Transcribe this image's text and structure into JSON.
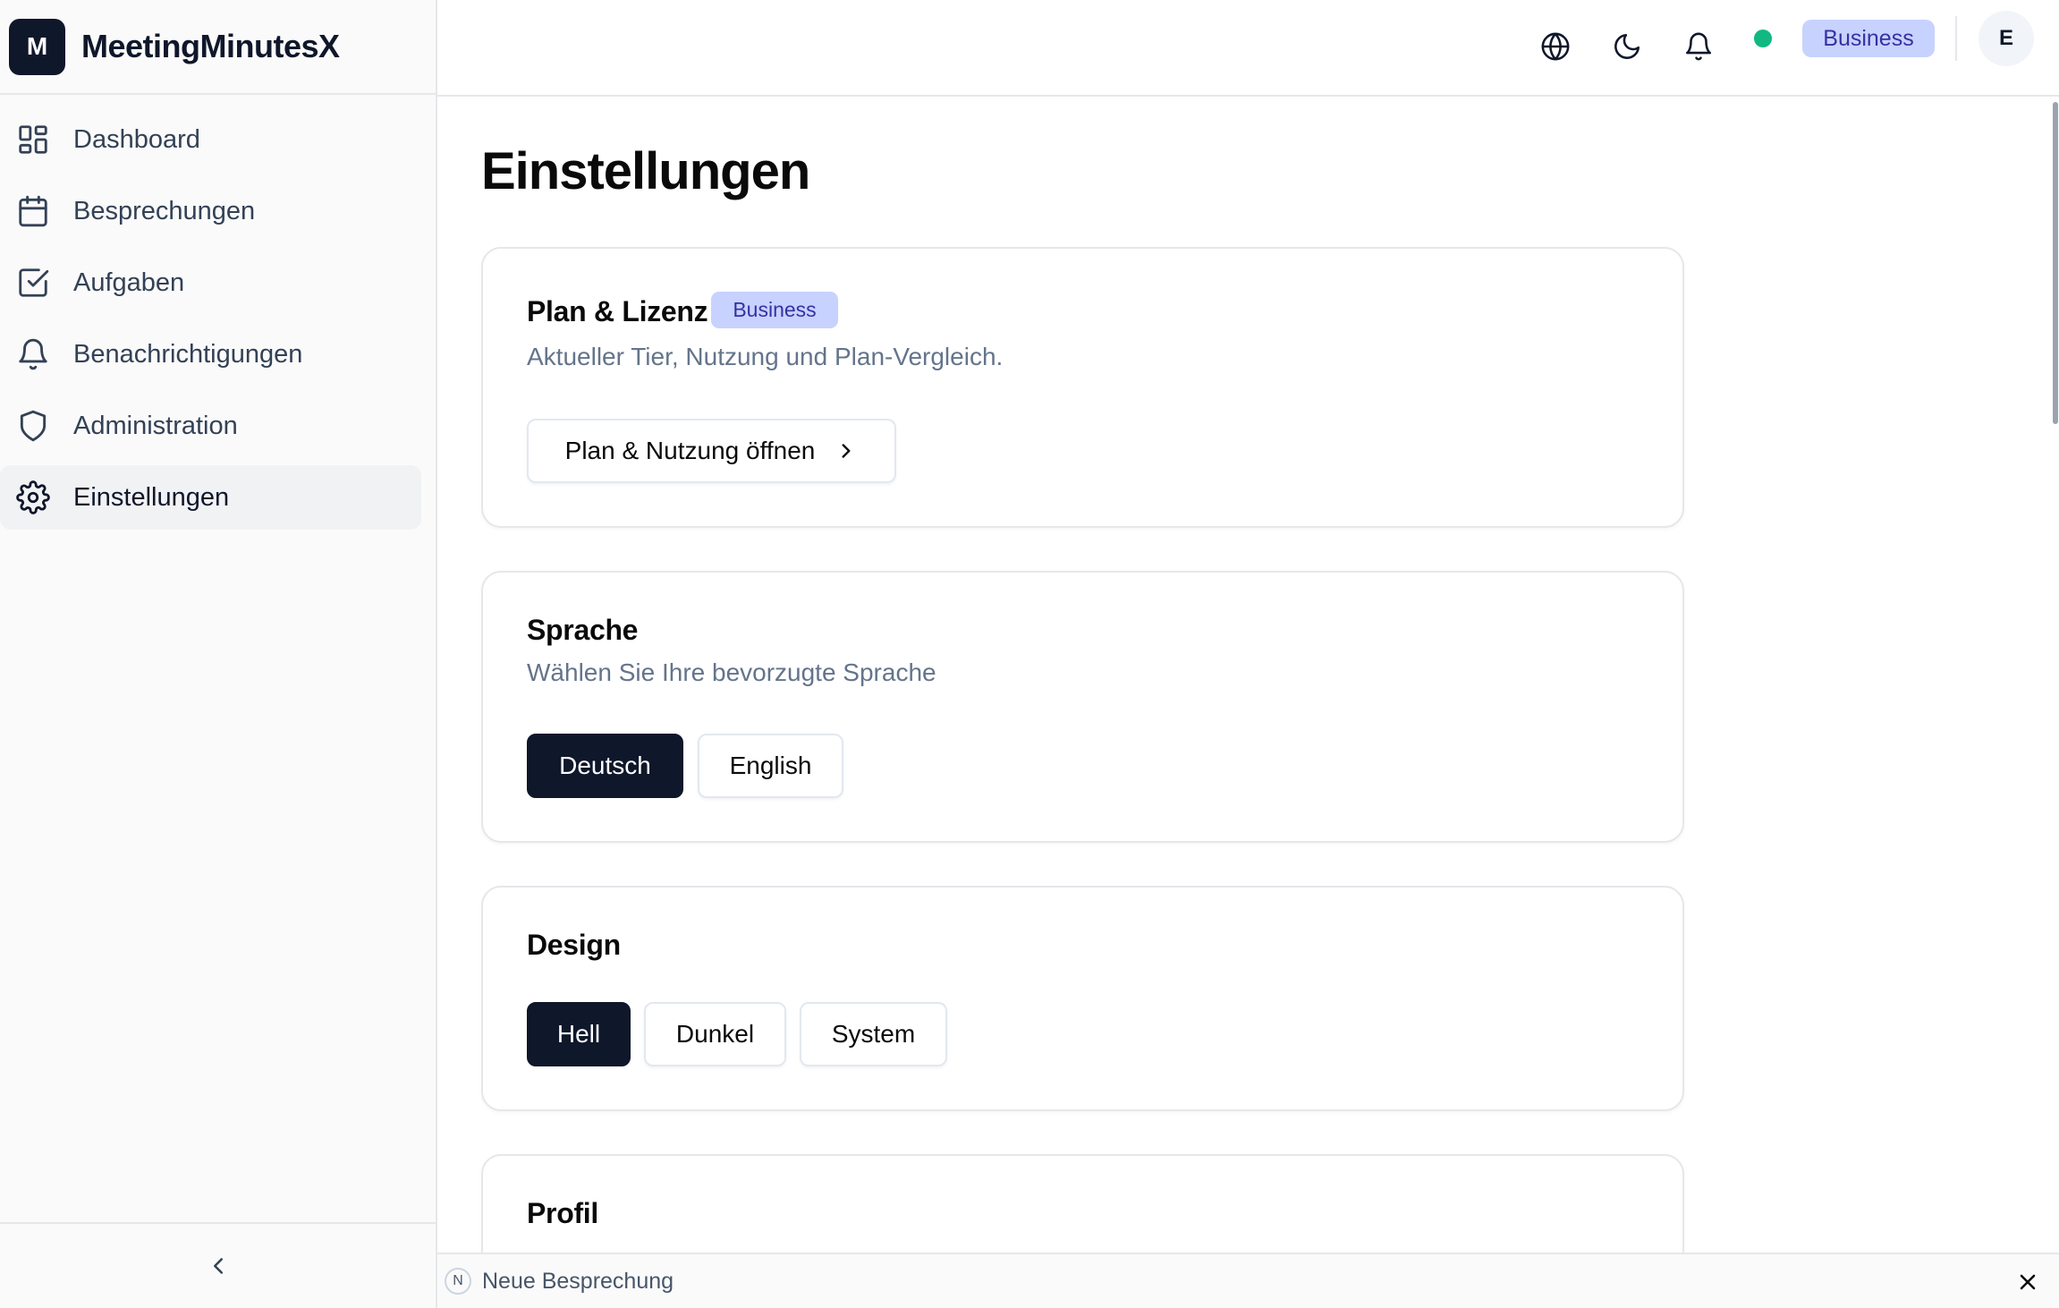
{
  "app": {
    "logo_letter": "M",
    "name": "MeetingMinutesX"
  },
  "sidebar": {
    "items": [
      {
        "label": "Dashboard",
        "icon": "layout-grid-icon"
      },
      {
        "label": "Besprechungen",
        "icon": "calendar-icon"
      },
      {
        "label": "Aufgaben",
        "icon": "check-square-icon"
      },
      {
        "label": "Benachrichtigungen",
        "icon": "bell-icon"
      },
      {
        "label": "Administration",
        "icon": "shield-icon"
      },
      {
        "label": "Einstellungen",
        "icon": "gear-icon",
        "active": true
      }
    ],
    "collapse_icon": "chevron-left-icon"
  },
  "header": {
    "icons": [
      "globe-icon",
      "moon-icon",
      "bell-icon"
    ],
    "status_color": "#10b981",
    "plan_badge": "Business",
    "avatar_initial": "E"
  },
  "page": {
    "title": "Einstellungen",
    "plan_card": {
      "title": "Plan & Lizenz",
      "badge": "Business",
      "description": "Aktueller Tier, Nutzung und Plan-Vergleich.",
      "button": "Plan & Nutzung öffnen"
    },
    "language_card": {
      "title": "Sprache",
      "description": "Wählen Sie Ihre bevorzugte Sprache",
      "options": [
        "Deutsch",
        "English"
      ],
      "selected": "Deutsch"
    },
    "design_card": {
      "title": "Design",
      "options": [
        "Hell",
        "Dunkel",
        "System"
      ],
      "selected": "Hell"
    },
    "profile_card": {
      "title": "Profil"
    }
  },
  "bottom_bar": {
    "badge": "N",
    "label": "Neue Besprechung"
  },
  "colors": {
    "primary": "#0f172a",
    "badge_bg": "#c7d2fe",
    "badge_text": "#3730a3"
  }
}
